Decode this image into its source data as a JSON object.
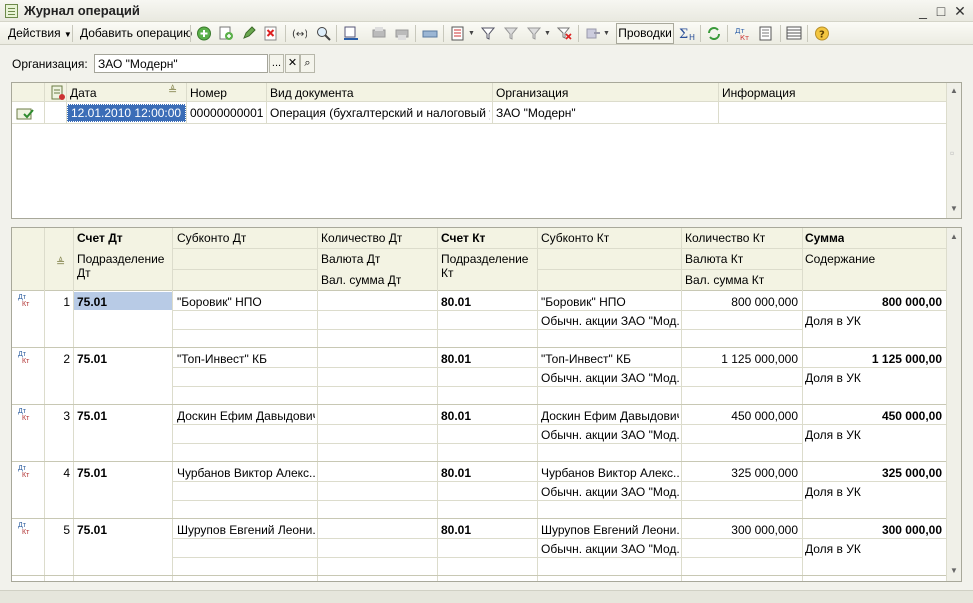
{
  "window": {
    "title": "Журнал операций"
  },
  "toolbar": {
    "actions_label": "Действия",
    "add_label": "Добавить операцию",
    "provodki_label": "Проводки"
  },
  "filter": {
    "org_label": "Организация:",
    "org_value": "ЗАО \"Модерн\"",
    "dots": "..."
  },
  "journal": {
    "columns": [
      "Дата",
      "Номер",
      "Вид документа",
      "Организация",
      "Информация"
    ],
    "rows": [
      {
        "date": "12.01.2010 12:00:00",
        "number": "00000000001",
        "doc_type": "Операция (бухгалтерский и налоговый у...",
        "org": "ЗАО \"Модерн\"",
        "info": ""
      }
    ]
  },
  "entries": {
    "headers": {
      "dt_account": "Счет Дт",
      "dt_subconto": "Субконто Дт",
      "dt_qty": "Количество Дт",
      "kt_account": "Счет Кт",
      "kt_subconto": "Субконто Кт",
      "kt_qty": "Количество Кт",
      "sum": "Сумма",
      "dt_dept": "Подразделение Дт",
      "dt_currency": "Валюта Дт",
      "dt_cur_sum": "Вал. сумма Дт",
      "kt_dept": "Подразделение Кт",
      "kt_currency": "Валюта Кт",
      "kt_cur_sum": "Вал. сумма Кт",
      "content": "Содержание"
    },
    "icon_dt": "Дт",
    "icon_kt": "Кт",
    "rows": [
      {
        "n": "1",
        "dt": "75.01",
        "dt_sub": "\"Боровик\" НПО",
        "kt": "80.01",
        "kt_sub1": "\"Боровик\" НПО",
        "kt_sub2": "Обычн. акции ЗАО \"Мод...",
        "kt_qty": "800 000,000",
        "sum": "800 000,00",
        "content": "Доля в УК"
      },
      {
        "n": "2",
        "dt": "75.01",
        "dt_sub": "\"Топ-Инвест\" КБ",
        "kt": "80.01",
        "kt_sub1": "\"Топ-Инвест\" КБ",
        "kt_sub2": "Обычн. акции ЗАО \"Мод...",
        "kt_qty": "1 125 000,000",
        "sum": "1 125 000,00",
        "content": "Доля в УК"
      },
      {
        "n": "3",
        "dt": "75.01",
        "dt_sub": "Доскин Ефим Давыдович",
        "kt": "80.01",
        "kt_sub1": "Доскин Ефим Давыдович",
        "kt_sub2": "Обычн. акции ЗАО \"Мод...",
        "kt_qty": "450 000,000",
        "sum": "450 000,00",
        "content": "Доля в УК"
      },
      {
        "n": "4",
        "dt": "75.01",
        "dt_sub": "Чурбанов Виктор Алекс...",
        "kt": "80.01",
        "kt_sub1": "Чурбанов Виктор Алекс...",
        "kt_sub2": "Обычн. акции ЗАО \"Мод...",
        "kt_qty": "325 000,000",
        "sum": "325 000,00",
        "content": "Доля в УК"
      },
      {
        "n": "5",
        "dt": "75.01",
        "dt_sub": "Шурупов Евгений Леони...",
        "kt": "80.01",
        "kt_sub1": "Шурупов Евгений Леони...",
        "kt_sub2": "Обычн. акции ЗАО \"Мод...",
        "kt_qty": "300 000,000",
        "sum": "300 000,00",
        "content": "Доля в УК"
      }
    ]
  }
}
